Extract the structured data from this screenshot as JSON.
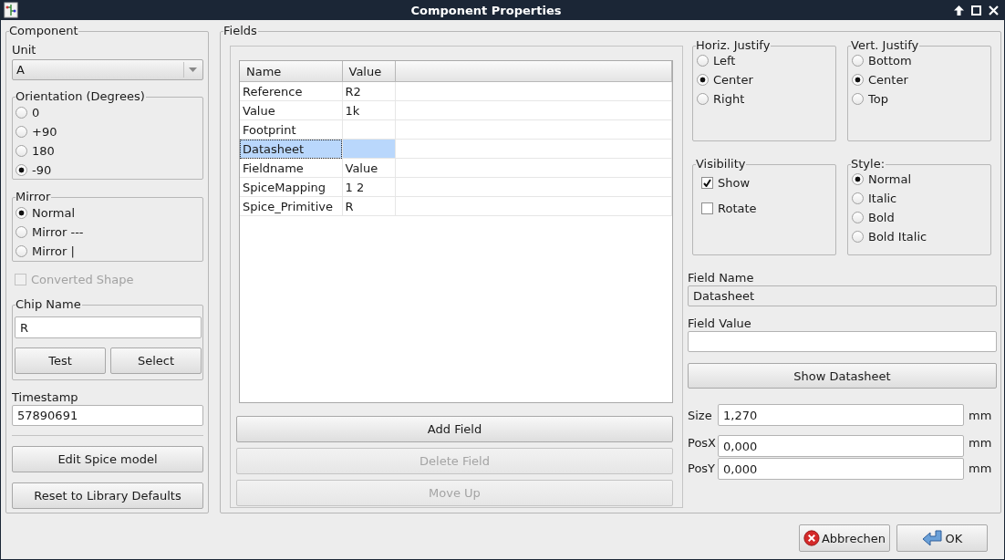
{
  "window": {
    "title": "Component Properties"
  },
  "component": {
    "title": "Component",
    "unit": {
      "label": "Unit",
      "value": "A"
    },
    "orientation": {
      "title": "Orientation (Degrees)",
      "options": [
        {
          "label": "0",
          "selected": false
        },
        {
          "label": "+90",
          "selected": false
        },
        {
          "label": "180",
          "selected": false
        },
        {
          "label": "-90",
          "selected": true
        }
      ]
    },
    "mirror": {
      "title": "Mirror",
      "options": [
        {
          "label": "Normal",
          "selected": true
        },
        {
          "label": "Mirror ---",
          "selected": false
        },
        {
          "label": "Mirror |",
          "selected": false
        }
      ]
    },
    "converted_shape": {
      "label": "Converted Shape",
      "checked": false,
      "disabled": true
    },
    "chip_name": {
      "title": "Chip Name",
      "value": "R",
      "buttons": [
        "Test",
        "Select"
      ]
    },
    "timestamp": {
      "label": "Timestamp",
      "value": "57890691"
    },
    "buttons": [
      "Edit Spice model",
      "Reset to Library Defaults"
    ]
  },
  "fields": {
    "title": "Fields",
    "table": {
      "columns": [
        "Name",
        "Value"
      ],
      "rows": [
        {
          "name": "Reference",
          "value": "R2",
          "selected": false
        },
        {
          "name": "Value",
          "value": "1k",
          "selected": false
        },
        {
          "name": "Footprint",
          "selected": false
        },
        {
          "name": "Datasheet",
          "selected": true
        },
        {
          "name": "Fieldname",
          "value": "Value",
          "selected": false
        },
        {
          "name": "SpiceMapping",
          "value": "1 2",
          "selected": false
        },
        {
          "name": "Spice_Primitive",
          "value": "R",
          "selected": false
        }
      ]
    },
    "buttons": [
      {
        "label": "Add Field",
        "disabled": false
      },
      {
        "label": "Delete Field",
        "disabled": true
      },
      {
        "label": "Move Up",
        "disabled": true
      }
    ],
    "horiz_justify": {
      "title": "Horiz. Justify",
      "options": [
        {
          "label": "Left",
          "selected": false
        },
        {
          "label": "Center",
          "selected": true
        },
        {
          "label": "Right",
          "selected": false
        }
      ]
    },
    "vert_justify": {
      "title": "Vert. Justify",
      "options": [
        {
          "label": "Bottom",
          "selected": false
        },
        {
          "label": "Center",
          "selected": true
        },
        {
          "label": "Top",
          "selected": false
        }
      ]
    },
    "visibility": {
      "title": "Visibility",
      "options": [
        {
          "label": "Show",
          "checked": true
        },
        {
          "label": "Rotate",
          "checked": false
        }
      ]
    },
    "style": {
      "title": "Style:",
      "options": [
        {
          "label": "Normal",
          "selected": true
        },
        {
          "label": "Italic",
          "selected": false
        },
        {
          "label": "Bold",
          "selected": false
        },
        {
          "label": "Bold Italic",
          "selected": false
        }
      ]
    },
    "field_name": {
      "label": "Field Name",
      "value": "Datasheet",
      "disabled": true
    },
    "field_value": {
      "label": "Field Value",
      "disabled": false
    },
    "show_datasheet": "Show Datasheet",
    "size": {
      "label": "Size",
      "value": "1,270",
      "unit": "mm"
    },
    "pos_x": {
      "label": "PosX",
      "value": "0,000",
      "unit": "mm"
    },
    "pos_y": {
      "label": "PosY",
      "value": "0,000",
      "unit": "mm"
    }
  },
  "dialog_buttons": [
    {
      "label": "Abbrechen",
      "kind": "cancel"
    },
    {
      "label": "OK",
      "kind": "ok"
    }
  ]
}
